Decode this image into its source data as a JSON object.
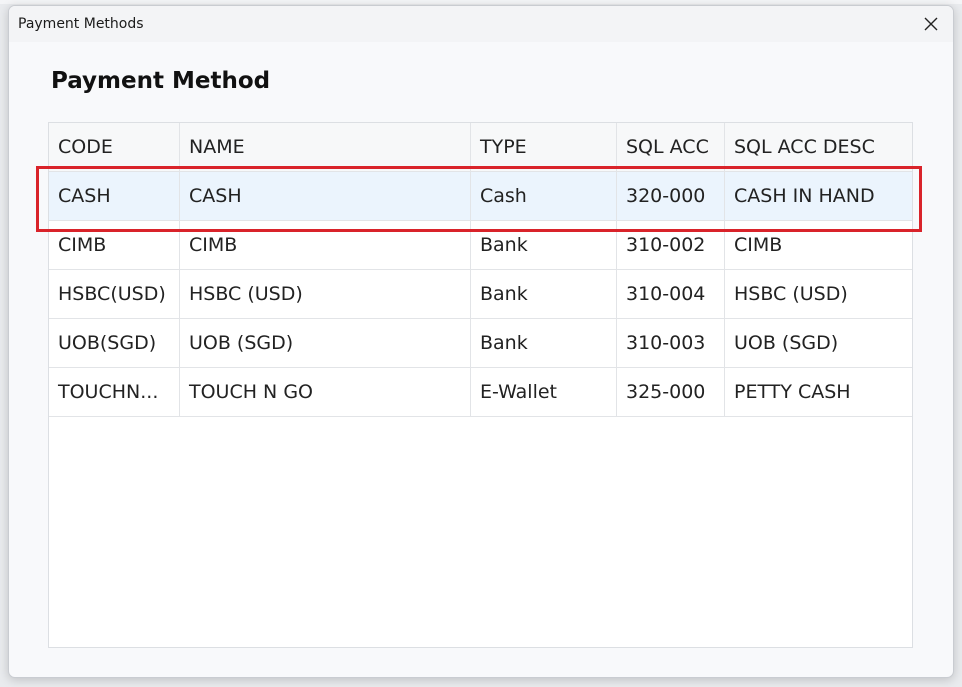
{
  "window": {
    "title": "Payment Methods"
  },
  "page": {
    "heading": "Payment Method"
  },
  "table": {
    "columns": [
      "CODE",
      "NAME",
      "TYPE",
      "SQL ACC",
      "SQL ACC DESC"
    ],
    "rows": [
      [
        "CASH",
        "CASH",
        "Cash",
        "320-000",
        "CASH IN HAND"
      ],
      [
        "CIMB",
        "CIMB",
        "Bank",
        "310-002",
        "CIMB"
      ],
      [
        "HSBC(USD)",
        "HSBC (USD)",
        "Bank",
        "310-004",
        "HSBC (USD)"
      ],
      [
        "UOB(SGD)",
        "UOB (SGD)",
        "Bank",
        "310-003",
        "UOB (SGD)"
      ],
      [
        "TOUCHN...",
        "TOUCH N GO",
        "E-Wallet",
        "325-000",
        "PETTY CASH"
      ]
    ],
    "selected_row": 0
  },
  "colors": {
    "highlight": "#d9232a",
    "selected_row_bg": "#ebf4fd"
  },
  "icons": {
    "close": "close-icon"
  }
}
